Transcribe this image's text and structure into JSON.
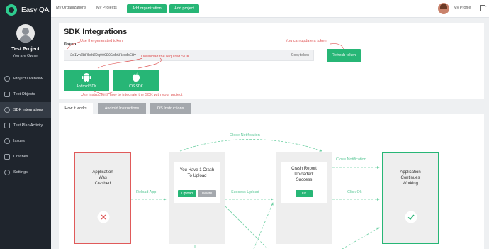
{
  "sidebar": {
    "brand": "Easy QA",
    "project_name": "Test Project",
    "project_role": "You are Owner",
    "items": [
      {
        "label": "Project Overview",
        "icon": "clock-icon"
      },
      {
        "label": "Test Objects",
        "icon": "folder-icon"
      },
      {
        "label": "SDK Integrations",
        "icon": "sdk-icon"
      },
      {
        "label": "Test Plan Activity",
        "icon": "activity-icon"
      },
      {
        "label": "Issues",
        "icon": "bug-icon"
      },
      {
        "label": "Crashes",
        "icon": "crash-icon"
      },
      {
        "label": "Settings",
        "icon": "gear-icon"
      }
    ],
    "active_index": 2
  },
  "topbar": {
    "my_organizations": "My Organizations",
    "my_projects": "My Projects",
    "add_organization": "Add organization",
    "add_project": "Add project",
    "my_profile": "My Profile"
  },
  "sdk": {
    "title": "SDK Integrations",
    "token_label": "Token",
    "token_value": "3dIvhZBF5qNZ9q90CD0GpbGFWsdbEHv",
    "copy_token": "Copy token",
    "refresh_token": "Refresh token",
    "android_sdk": "Android SDK",
    "ios_sdk": "iOS SDK",
    "annotations": {
      "use_token": "Use the generated token",
      "download_sdk": "Download the required SDK",
      "update_token": "You can update a token",
      "instructions": "Use instructions how to integrate the SDK with your project"
    }
  },
  "tabs": [
    {
      "label": "How it works",
      "active": true
    },
    {
      "label": "Android Instructions",
      "active": false
    },
    {
      "label": "iOS Instructions",
      "active": false
    }
  ],
  "flow": {
    "crashed": "Application\nWas\nCrashed",
    "upload_prompt": "You Have 1 Crash\nTo Upload",
    "upload_btn": "Upload",
    "delete_btn": "Delete",
    "report_uploaded": "Crash Report\nUploaded:\nSuccess",
    "ok_btn": "Ok",
    "continues": "Application\nContinues\nWorking",
    "labels": {
      "close_notification_top": "Close Notification",
      "close_notification_right": "Close Notification",
      "reload_app": "Reload App",
      "success_upload": "Success Upload",
      "click_ok": "Click Ok"
    }
  },
  "colors": {
    "accent": "#27b676",
    "annotation": "#e05a5a",
    "sidebar_bg": "#1f252d"
  }
}
